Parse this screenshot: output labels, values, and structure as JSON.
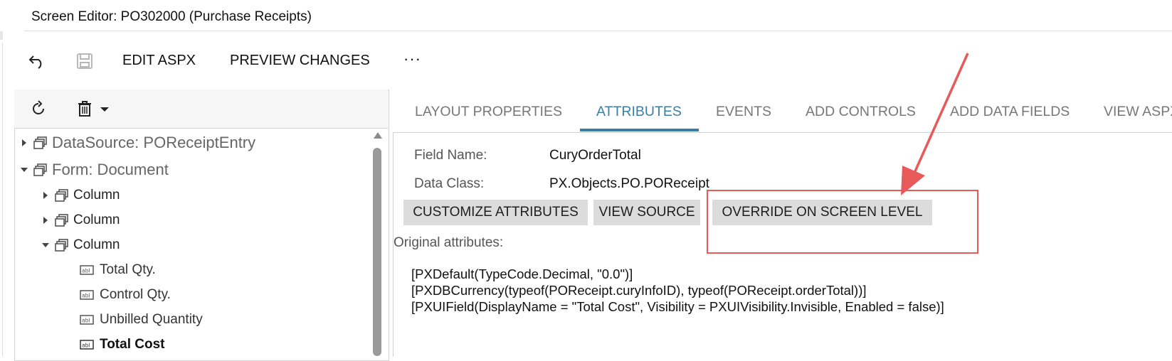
{
  "window": {
    "title": "Screen Editor: PO302000 (Purchase Receipts)"
  },
  "toolbar": {
    "undo_icon": "undo-icon",
    "save_icon": "save-icon",
    "edit_aspx_label": "EDIT ASPX",
    "preview_changes_label": "PREVIEW CHANGES",
    "more_label": "···"
  },
  "tree_toolbar": {
    "refresh_icon": "refresh-icon",
    "delete_icon": "trash-icon",
    "dropdown_icon": "caret-down-icon"
  },
  "tree": {
    "items": [
      {
        "label": "DataSource: POReceiptEntry",
        "level": 0,
        "state": "collapsed"
      },
      {
        "label": "Form: Document",
        "level": 0,
        "state": "expanded"
      },
      {
        "label": "Column",
        "level": 1,
        "state": "collapsed"
      },
      {
        "label": "Column",
        "level": 1,
        "state": "collapsed"
      },
      {
        "label": "Column",
        "level": 1,
        "state": "expanded"
      },
      {
        "label": "Total Qty.",
        "level": 2,
        "state": "field"
      },
      {
        "label": "Control Qty.",
        "level": 2,
        "state": "field"
      },
      {
        "label": "Unbilled Quantity",
        "level": 2,
        "state": "field"
      },
      {
        "label": "Total Cost",
        "level": 2,
        "state": "field",
        "selected": true
      }
    ]
  },
  "tabs": [
    {
      "label": "LAYOUT PROPERTIES",
      "active": false
    },
    {
      "label": "ATTRIBUTES",
      "active": true
    },
    {
      "label": "EVENTS",
      "active": false
    },
    {
      "label": "ADD CONTROLS",
      "active": false
    },
    {
      "label": "ADD DATA FIELDS",
      "active": false
    },
    {
      "label": "VIEW ASPX",
      "active": false
    }
  ],
  "attributes": {
    "field_name_label": "Field Name:",
    "field_name_value": "CuryOrderTotal",
    "data_class_label": "Data Class:",
    "data_class_value": "PX.Objects.PO.POReceipt",
    "buttons": {
      "customize": "CUSTOMIZE ATTRIBUTES",
      "view_source": "VIEW SOURCE",
      "override": "OVERRIDE ON SCREEN LEVEL"
    },
    "original_label": "Original attributes:",
    "code_lines": [
      "[PXDefault(TypeCode.Decimal, \"0.0\")]",
      "[PXDBCurrency(typeof(POReceipt.curyInfoID), typeof(POReceipt.orderTotal))]",
      "[PXUIField(DisplayName = \"Total Cost\", Visibility = PXUIVisibility.Invisible, Enabled = false)]"
    ]
  },
  "annotation": {
    "arrow_color": "#e85a5a",
    "box_color": "#e85a5a"
  }
}
